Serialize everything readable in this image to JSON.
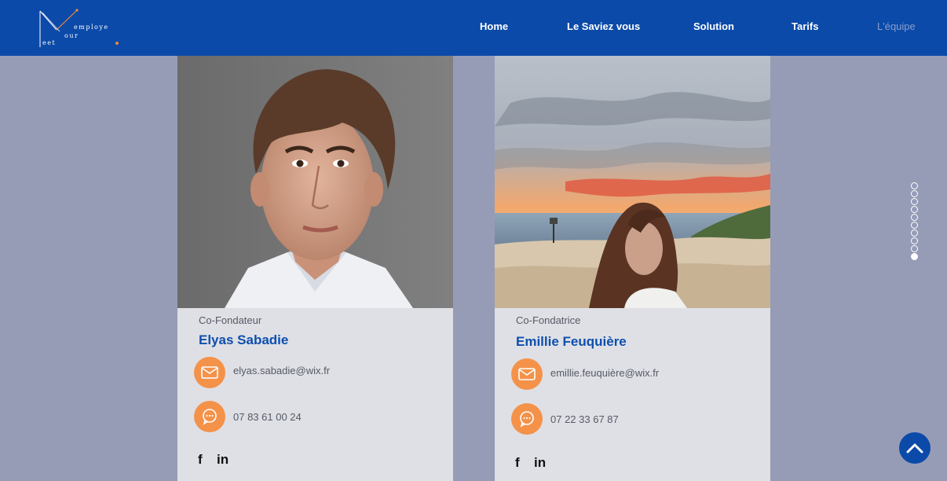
{
  "brand": {
    "logo_words": [
      "employe",
      "our",
      "eet"
    ],
    "accent_color": "#f0873a",
    "header_color": "#0b4aa8"
  },
  "nav": {
    "items": [
      {
        "label": "Home"
      },
      {
        "label": "Le Saviez vous"
      },
      {
        "label": "Solution"
      },
      {
        "label": "Tarifs"
      },
      {
        "label": "L'équipe"
      }
    ],
    "active": "L'équipe"
  },
  "team": [
    {
      "role": "Co-Fondateur",
      "name": "Elyas Sabadie",
      "email": "elyas.sabadie@wix.fr",
      "phone": "07 83 61 00 24",
      "social": [
        "f",
        "in"
      ]
    },
    {
      "role": "Co-Fondatrice",
      "name": "Emillie Feuquière",
      "email": "emillie.feuquière@wix.fr",
      "phone": "07 22 33 67 87",
      "social": [
        "f",
        "in"
      ]
    }
  ],
  "pager": {
    "total": 10,
    "active": 9
  },
  "icons": {
    "email": "envelope-icon",
    "phone": "chat-bubble-icon",
    "back_to_top": "chevron-up-icon"
  }
}
